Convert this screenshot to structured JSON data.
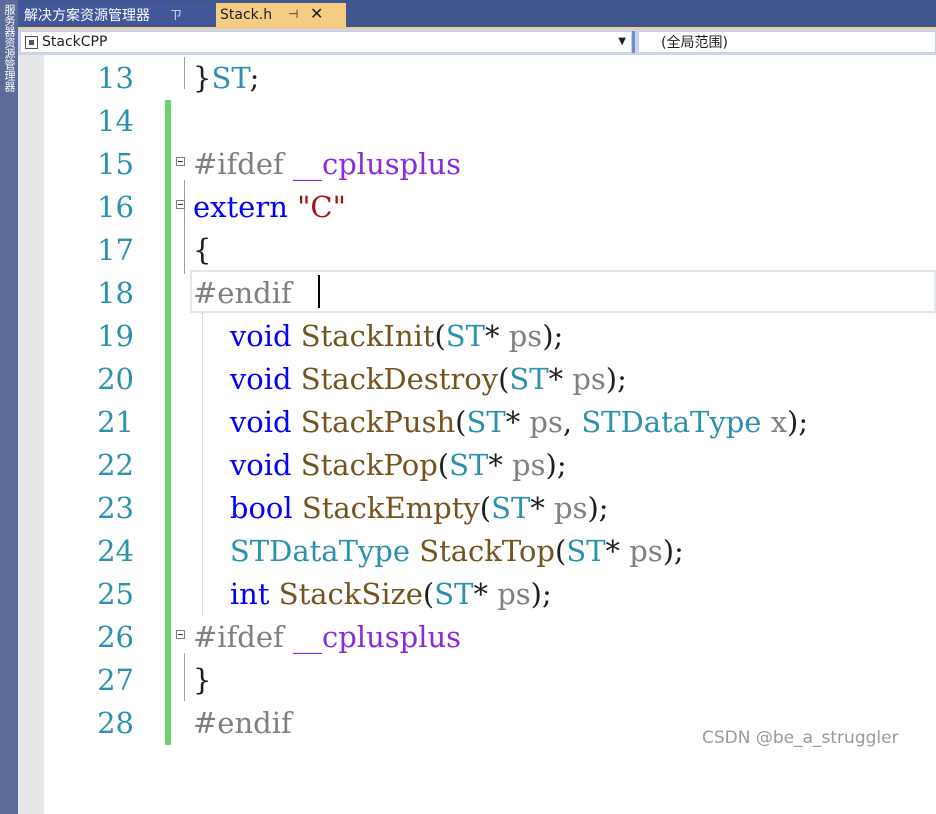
{
  "sidebar": {
    "label": "服务器资源管理器"
  },
  "tabs": {
    "solution": {
      "label": "解决方案资源管理器",
      "pin": "ㄗ"
    },
    "file": {
      "label": "Stack.h",
      "pin": "⊣",
      "close": "✕"
    }
  },
  "navbar": {
    "project": "StackCPP",
    "scope": "(全局范围)"
  },
  "editor": {
    "lines": [
      {
        "n": "13",
        "segs": [
          {
            "t": "}",
            "c": ""
          },
          {
            "t": "ST",
            "c": "typ"
          },
          {
            "t": ";",
            "c": ""
          }
        ]
      },
      {
        "n": "14",
        "segs": []
      },
      {
        "n": "15",
        "segs": [
          {
            "t": "#ifdef ",
            "c": "pp"
          },
          {
            "t": "__cplusplus",
            "c": "mac"
          }
        ]
      },
      {
        "n": "16",
        "segs": [
          {
            "t": "extern ",
            "c": "kw"
          },
          {
            "t": "\"C\"",
            "c": "str"
          }
        ]
      },
      {
        "n": "17",
        "segs": [
          {
            "t": "{",
            "c": ""
          }
        ]
      },
      {
        "n": "18",
        "segs": [
          {
            "t": "#endif ",
            "c": "pp"
          }
        ]
      },
      {
        "n": "19",
        "segs": [
          {
            "t": "    ",
            "c": ""
          },
          {
            "t": "void ",
            "c": "kw"
          },
          {
            "t": "StackInit",
            "c": "fn"
          },
          {
            "t": "(",
            "c": ""
          },
          {
            "t": "ST",
            "c": "typ"
          },
          {
            "t": "* ",
            "c": ""
          },
          {
            "t": "ps",
            "c": "prm"
          },
          {
            "t": ");",
            "c": ""
          }
        ]
      },
      {
        "n": "20",
        "segs": [
          {
            "t": "    ",
            "c": ""
          },
          {
            "t": "void ",
            "c": "kw"
          },
          {
            "t": "StackDestroy",
            "c": "fn"
          },
          {
            "t": "(",
            "c": ""
          },
          {
            "t": "ST",
            "c": "typ"
          },
          {
            "t": "* ",
            "c": ""
          },
          {
            "t": "ps",
            "c": "prm"
          },
          {
            "t": ");",
            "c": ""
          }
        ]
      },
      {
        "n": "21",
        "segs": [
          {
            "t": "    ",
            "c": ""
          },
          {
            "t": "void ",
            "c": "kw"
          },
          {
            "t": "StackPush",
            "c": "fn"
          },
          {
            "t": "(",
            "c": ""
          },
          {
            "t": "ST",
            "c": "typ"
          },
          {
            "t": "* ",
            "c": ""
          },
          {
            "t": "ps",
            "c": "prm"
          },
          {
            "t": ", ",
            "c": ""
          },
          {
            "t": "STDataType",
            "c": "typ"
          },
          {
            "t": " ",
            "c": ""
          },
          {
            "t": "x",
            "c": "prm"
          },
          {
            "t": ");",
            "c": ""
          }
        ]
      },
      {
        "n": "22",
        "segs": [
          {
            "t": "    ",
            "c": ""
          },
          {
            "t": "void ",
            "c": "kw"
          },
          {
            "t": "StackPop",
            "c": "fn"
          },
          {
            "t": "(",
            "c": ""
          },
          {
            "t": "ST",
            "c": "typ"
          },
          {
            "t": "* ",
            "c": ""
          },
          {
            "t": "ps",
            "c": "prm"
          },
          {
            "t": ");",
            "c": ""
          }
        ]
      },
      {
        "n": "23",
        "segs": [
          {
            "t": "    ",
            "c": ""
          },
          {
            "t": "bool ",
            "c": "kw"
          },
          {
            "t": "StackEmpty",
            "c": "fn"
          },
          {
            "t": "(",
            "c": ""
          },
          {
            "t": "ST",
            "c": "typ"
          },
          {
            "t": "* ",
            "c": ""
          },
          {
            "t": "ps",
            "c": "prm"
          },
          {
            "t": ");",
            "c": ""
          }
        ]
      },
      {
        "n": "24",
        "segs": [
          {
            "t": "    ",
            "c": ""
          },
          {
            "t": "STDataType",
            "c": "typ"
          },
          {
            "t": " ",
            "c": ""
          },
          {
            "t": "StackTop",
            "c": "fn"
          },
          {
            "t": "(",
            "c": ""
          },
          {
            "t": "ST",
            "c": "typ"
          },
          {
            "t": "* ",
            "c": ""
          },
          {
            "t": "ps",
            "c": "prm"
          },
          {
            "t": ");",
            "c": ""
          }
        ]
      },
      {
        "n": "25",
        "segs": [
          {
            "t": "    ",
            "c": ""
          },
          {
            "t": "int ",
            "c": "kw"
          },
          {
            "t": "StackSize",
            "c": "fn"
          },
          {
            "t": "(",
            "c": ""
          },
          {
            "t": "ST",
            "c": "typ"
          },
          {
            "t": "* ",
            "c": ""
          },
          {
            "t": "ps",
            "c": "prm"
          },
          {
            "t": ");",
            "c": ""
          }
        ]
      },
      {
        "n": "26",
        "segs": [
          {
            "t": "#ifdef ",
            "c": "pp"
          },
          {
            "t": "__cplusplus",
            "c": "mac"
          }
        ]
      },
      {
        "n": "27",
        "segs": [
          {
            "t": "}",
            "c": ""
          }
        ]
      },
      {
        "n": "28",
        "segs": [
          {
            "t": "#endif",
            "c": "pp"
          }
        ]
      }
    ]
  },
  "watermark": "CSDN @be_a_struggler",
  "colors": {
    "keyword": "#0000ff",
    "preprocessor": "#808080",
    "macro": "#8a2be2",
    "string": "#a31515",
    "type": "#2b91af",
    "function": "#74531f",
    "change_bar": "#6bd36b",
    "tab_active": "#f5cc84"
  }
}
